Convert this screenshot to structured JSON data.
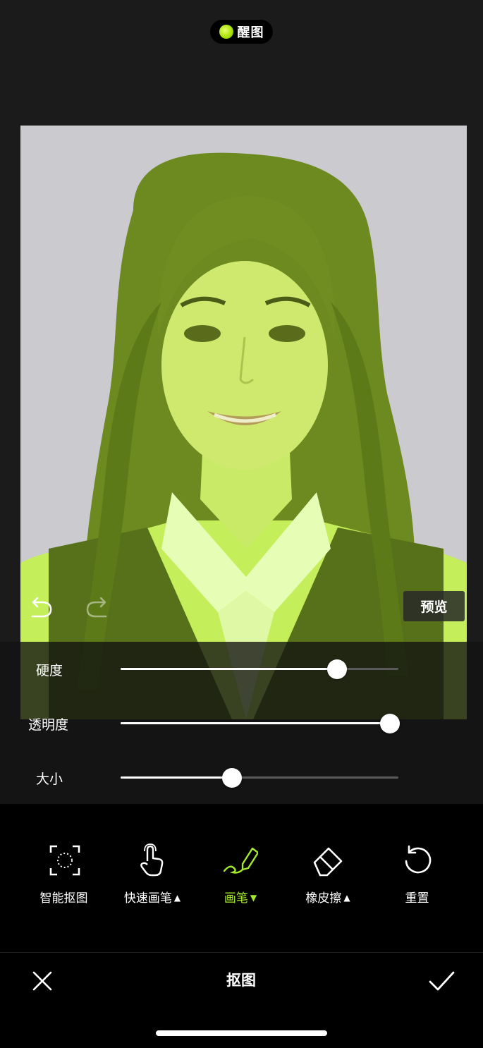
{
  "app": {
    "brand_name": "醒图",
    "accent_color": "#a4ea2b"
  },
  "canvas": {
    "mask_color": "#b5e61f",
    "undo_icon": "undo-icon",
    "redo_icon": "redo-icon",
    "preview_label": "预览"
  },
  "sliders": [
    {
      "label": "硬度",
      "value": 0.78
    },
    {
      "label": "透明度",
      "value": 0.97
    },
    {
      "label": "大小",
      "value": 0.4
    }
  ],
  "tools": [
    {
      "label": "智能抠图",
      "icon": "smart-cutout-icon",
      "arrow": ""
    },
    {
      "label": "快速画笔",
      "icon": "hand-pointer-icon",
      "arrow": "▲"
    },
    {
      "label": "画笔",
      "icon": "brush-icon",
      "arrow": "▼"
    },
    {
      "label": "橡皮擦",
      "icon": "eraser-icon",
      "arrow": "▲"
    },
    {
      "label": "重置",
      "icon": "reset-icon",
      "arrow": ""
    }
  ],
  "bottom_bar": {
    "title": "抠图",
    "close_icon": "close-icon",
    "confirm_icon": "checkmark-icon"
  }
}
